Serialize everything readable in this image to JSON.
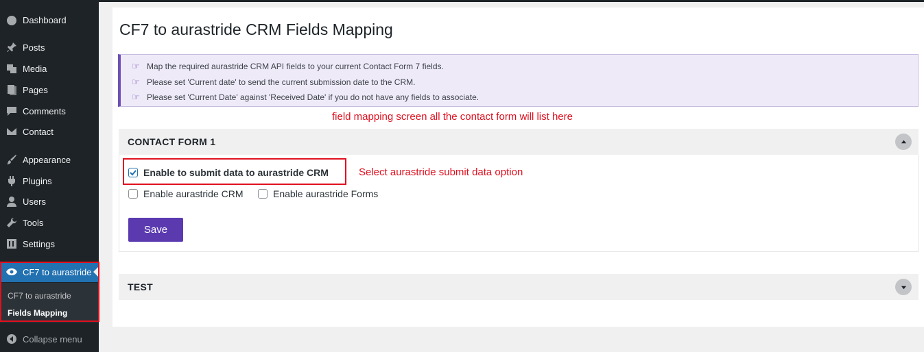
{
  "sidebar": {
    "items": [
      {
        "label": "Dashboard",
        "icon": "dashboard-icon"
      },
      {
        "label": "Posts",
        "icon": "pin-icon"
      },
      {
        "label": "Media",
        "icon": "media-icon"
      },
      {
        "label": "Pages",
        "icon": "pages-icon"
      },
      {
        "label": "Comments",
        "icon": "comment-icon"
      },
      {
        "label": "Contact",
        "icon": "mail-icon"
      },
      {
        "label": "Appearance",
        "icon": "brush-icon"
      },
      {
        "label": "Plugins",
        "icon": "plugin-icon"
      },
      {
        "label": "Users",
        "icon": "user-icon"
      },
      {
        "label": "Tools",
        "icon": "wrench-icon"
      },
      {
        "label": "Settings",
        "icon": "settings-icon"
      },
      {
        "label": "CF7 to aurastride",
        "icon": "eye-icon"
      }
    ],
    "submenu": [
      "CF7 to aurastride",
      "Fields Mapping"
    ],
    "collapse_label": "Collapse menu"
  },
  "page": {
    "title": "CF7 to aurastride CRM Fields Mapping",
    "notices": [
      "Map the required aurastride CRM API fields to your current Contact Form 7 fields.",
      "Please set 'Current date' to send the current submission date to the CRM.",
      "Please set 'Current Date' against 'Received Date' if you do not have any fields to associate."
    ],
    "annotation_top": "field mapping screen all the contact form will list here",
    "annotation_checkbox": "Select aurastride submit data option"
  },
  "forms": [
    {
      "name": "CONTACT FORM 1",
      "expanded": true,
      "options": [
        {
          "label": "Enable to submit data to aurastride CRM",
          "checked": true
        },
        {
          "label": "Enable aurastride CRM",
          "checked": false
        },
        {
          "label": "Enable aurastride Forms",
          "checked": false
        }
      ],
      "save_label": "Save"
    },
    {
      "name": "TEST",
      "expanded": false
    }
  ],
  "colors": {
    "sidebar_bg": "#1d2327",
    "active_menu": "#2271b1",
    "save_button": "#5b3ab0",
    "annotation_red": "#e0101f",
    "notice_bg": "#efeaf8"
  }
}
